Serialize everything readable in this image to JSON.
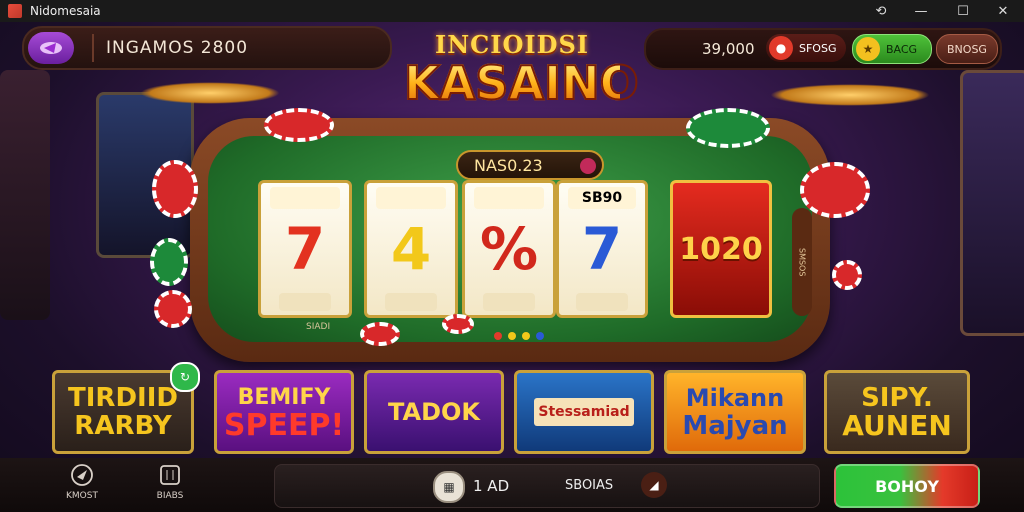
{
  "window": {
    "title": "Nidomesaia",
    "controls": [
      "restore-icon",
      "minimize-icon",
      "maximize-icon",
      "close-icon"
    ]
  },
  "header": {
    "player_name": "INGAMOS 2800",
    "balance": "39,000",
    "coins_label": "SFOSG",
    "gems_label": "BACG",
    "menu_label": "BNOSG"
  },
  "logo": {
    "line1": "INCIOIDSI",
    "line2": "KASAINO"
  },
  "slot": {
    "win_display": "NAS0.23",
    "reels": [
      {
        "symbol": "7",
        "color": "#e3321f",
        "cap": ""
      },
      {
        "symbol": "4",
        "color": "#f2c81a",
        "cap": ""
      },
      {
        "symbol": "%",
        "color": "#d1281c",
        "cap": ""
      },
      {
        "symbol": "7",
        "color": "#2a5ad6",
        "cap": "SB90"
      },
      {
        "symbol": "1020",
        "color": "#ffd24a",
        "cap": ""
      }
    ],
    "felt_label": "SIADI",
    "lever_label": "SMSOS"
  },
  "games": [
    {
      "line1": "TIRDIID",
      "line2": "RARBY",
      "bg": "#3a2e28",
      "color": "#f6c51e"
    },
    {
      "line1": "BEMIFY",
      "line2": "SPEEP!",
      "bg": "#7a1f9c",
      "color": "#ffd54a"
    },
    {
      "line1": "",
      "line2": "TADOK",
      "bg": "#5a1f8c",
      "color": "#ffd54a"
    },
    {
      "line1": "",
      "line2": "Stessamiad",
      "bg": "#1e5aa8",
      "color": "#ffffff"
    },
    {
      "line1": "Mikann",
      "line2": "Majyan",
      "bg": "#f29a16",
      "color": "#2a4ab0"
    },
    {
      "line1": "SIPY.",
      "line2": "AUNEN",
      "bg": "#4a3a2c",
      "color": "#f6c51e"
    }
  ],
  "bottom": {
    "nav": [
      {
        "label": "KMOST",
        "icon": "send-icon"
      },
      {
        "label": "BIABS",
        "icon": "slots-icon"
      }
    ],
    "bet_value": "1 AD",
    "bet_label": "SBOIAS",
    "spin_label": "BOHOY"
  }
}
